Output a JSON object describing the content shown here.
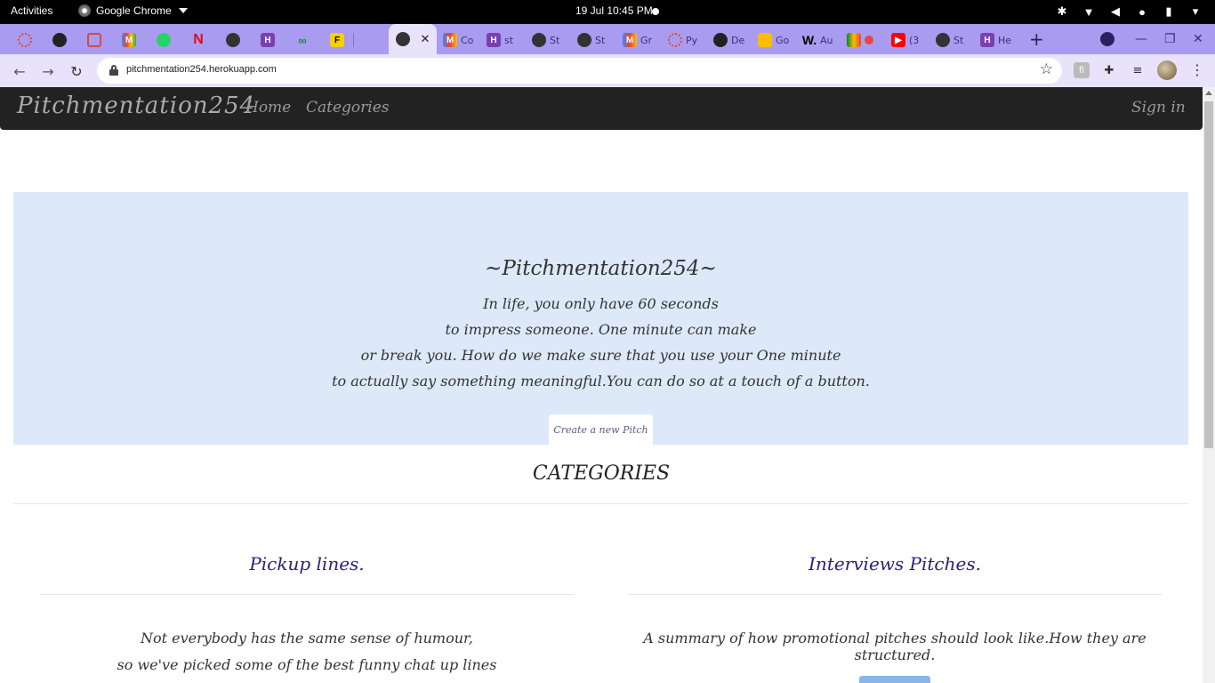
{
  "system_bar": {
    "activities": "Activities",
    "app_name": "Google Chrome",
    "clock": "19 Jul  10:45 PM"
  },
  "browser": {
    "active_tab_favicon": "globe-icon",
    "tabs": [
      {
        "favicon": "ring-icon",
        "label": ""
      },
      {
        "favicon": "github-icon",
        "label": ""
      },
      {
        "favicon": "spiral-icon",
        "label": ""
      },
      {
        "favicon": "gmail-icon",
        "label": ""
      },
      {
        "favicon": "whatsapp-icon",
        "label": ""
      },
      {
        "favicon": "netflix-icon",
        "label": ""
      },
      {
        "favicon": "globe-icon",
        "label": ""
      },
      {
        "favicon": "heroku-icon",
        "label": ""
      },
      {
        "favicon": "infinity-icon",
        "label": ""
      },
      {
        "favicon": "f-icon",
        "label": ""
      },
      {
        "favicon": "gmail-icon",
        "label": "Co"
      },
      {
        "favicon": "heroku-icon",
        "label": "st"
      },
      {
        "favicon": "globe-icon",
        "label": "St"
      },
      {
        "favicon": "globe-icon",
        "label": "St"
      },
      {
        "favicon": "gmail-icon",
        "label": "Gr"
      },
      {
        "favicon": "ring-icon",
        "label": "Py"
      },
      {
        "favicon": "github-icon",
        "label": "De"
      },
      {
        "favicon": "keep-icon",
        "label": "Go"
      },
      {
        "favicon": "w-icon",
        "label": "Au"
      },
      {
        "favicon": "meet-icon",
        "label": ""
      },
      {
        "favicon": "youtube-icon",
        "label": "(3"
      },
      {
        "favicon": "globe-icon",
        "label": "St"
      },
      {
        "favicon": "heroku-icon",
        "label": "He"
      }
    ],
    "url": "pitchmentation254.herokuapp.com"
  },
  "navbar": {
    "brand": "Pitchmentation254",
    "links": [
      "Home",
      "Categories"
    ],
    "sign_in": "Sign in"
  },
  "hero": {
    "title": "~Pitchmentation254~",
    "lines": [
      "In life, you only have 60 seconds",
      "to impress someone. One minute can make",
      "or break you. How do we make sure that you use your One minute",
      "to actually say something meaningful.You can do so at a touch of a button."
    ],
    "button": "Create a new Pitch"
  },
  "categories": {
    "heading": "CATEGORIES",
    "cards": [
      {
        "title": "Pickup lines.",
        "lines": [
          "Not everybody has the same sense of humour,",
          "so we've picked some of the best funny chat up lines"
        ]
      },
      {
        "title": "Interviews Pitches.",
        "lines": [
          "A summary of how promotional pitches should look like.How they are structured."
        ]
      }
    ]
  }
}
